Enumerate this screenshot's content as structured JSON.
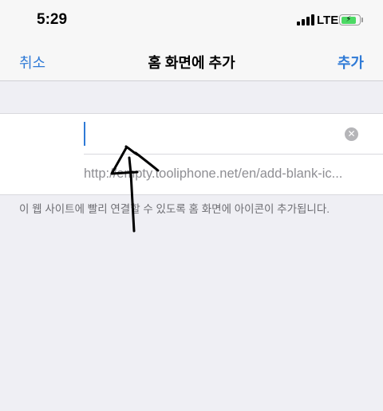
{
  "status_bar": {
    "time": "5:29",
    "network": "LTE",
    "signal_bars": 4,
    "battery_color": "#4cd964",
    "battery_level": 0.85
  },
  "nav": {
    "cancel_label": "취소",
    "title": "홈 화면에 추가",
    "add_label": "추가",
    "accent_color": "#2f7ad6"
  },
  "form": {
    "name_value": "",
    "url": "http://empty.tooliphone.net/en/add-blank-ic..."
  },
  "description": "이 웹 사이트에 빨리 연결할 수 있도록 홈 화면에 아이콘이 추가됩니다."
}
